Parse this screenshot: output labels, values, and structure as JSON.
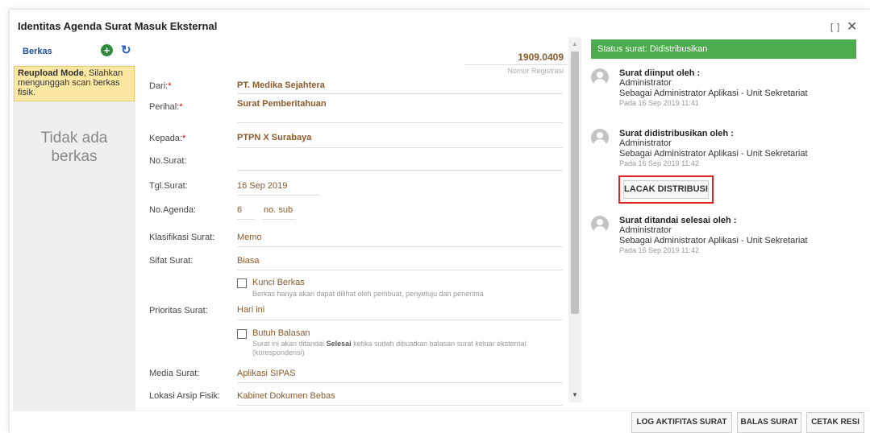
{
  "dialog": {
    "title": "Identitas Agenda Surat Masuk Eksternal",
    "maximize_icon": "[ ]",
    "close_icon": "✕"
  },
  "files": {
    "label": "Berkas",
    "add_icon": "+",
    "refresh_icon": "↻",
    "notice_bold": "Reupload Mode",
    "notice_text": ", Silahkan mengunggah scan berkas fisik.",
    "empty_line1": "Tidak ada",
    "empty_line2": "berkas"
  },
  "form": {
    "registration_number": "1909.0409",
    "registration_label": "Nomor Registrasi",
    "dari_label": "Dari:",
    "dari_value": "PT. Medika Sejahtera",
    "perihal_label": "Perihal:",
    "perihal_value": "Surat Pemberitahuan",
    "kepada_label": "Kepada:",
    "kepada_value": "PTPN X Surabaya",
    "nosurat_label": "No.Surat:",
    "nosurat_value": "",
    "tglsurat_label": "Tgl.Surat:",
    "tglsurat_value": "16 Sep 2019",
    "noagenda_label": "No.Agenda:",
    "noagenda_value": "6",
    "noagenda_sub": "no. sub",
    "klasifikasi_label": "Klasifikasi Surat:",
    "klasifikasi_value": "Memo",
    "sifat_label": "Sifat Surat:",
    "sifat_value": "Biasa",
    "kunci_label": "Kunci Berkas",
    "kunci_help": "Berkas hanya akan dapat dilihat oleh pembuat, penyetuju dan penerima",
    "prioritas_label": "Prioritas Surat:",
    "prioritas_value": "Hari ini",
    "butuh_label": "Butuh Balasan",
    "butuh_help_1": "Surat ini akan ditandai ",
    "butuh_help_bold": "Selesai",
    "butuh_help_2": " ketika sudah dibuatkan balasan surat keluar eksternal (korespondensi)",
    "media_label": "Media Surat:",
    "media_value": "Aplikasi SIPAS",
    "lokasi_label": "Lokasi Arsip Fisik:",
    "lokasi_value": "Kabinet Dokumen Bebas"
  },
  "status": {
    "header": "Status surat: Didistribusikan",
    "entries": [
      {
        "title": "Surat diinput oleh :",
        "name": "Administrator",
        "role": "Sebagai Administrator Aplikasi - Unit Sekretariat",
        "time": "Pada 16 Sep 2019 11:41"
      },
      {
        "title": "Surat didistribusikan oleh :",
        "name": "Administrator",
        "role": "Sebagai Administrator Aplikasi - Unit Sekretariat",
        "time": "Pada 16 Sep 2019 11:42"
      },
      {
        "title": "Surat ditandai selesai oleh :",
        "name": "Administrator",
        "role": "Sebagai Administrator Aplikasi - Unit Sekretariat",
        "time": "Pada 16 Sep 2019 11:42"
      }
    ],
    "lacak_button": "LACAK DISTRIBUSI"
  },
  "footer": {
    "log_button": "LOG AKTIFITAS SURAT",
    "balas_button": "BALAS SURAT",
    "cetak_button": "CETAK RESI"
  },
  "colors": {
    "status_green": "#4cab4d",
    "value_brown": "#8b5a2b",
    "notice_yellow": "#fce7a3",
    "highlight_red": "#d22222",
    "link_blue": "#1f4f9f"
  }
}
